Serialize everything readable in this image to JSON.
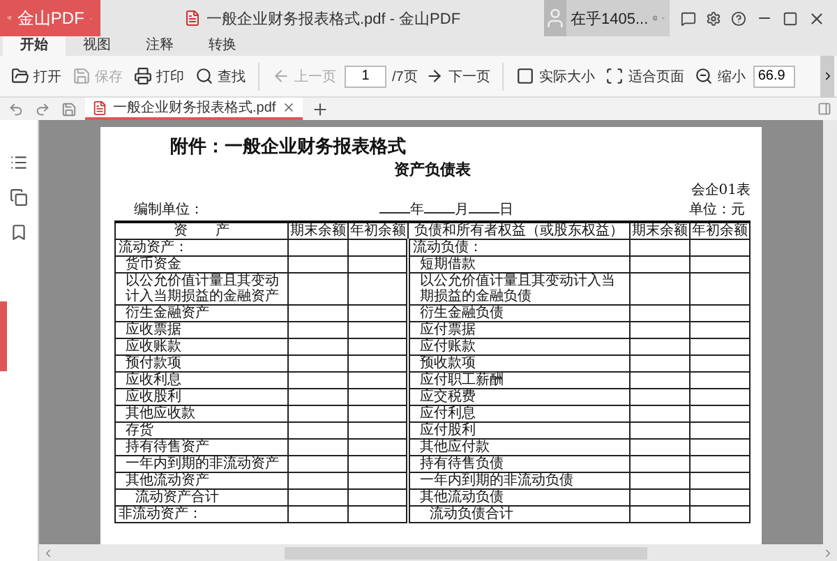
{
  "app": {
    "logo": "金山PDF",
    "title": "一般企业财务报表格式.pdf - 金山PDF",
    "user": "在乎1405..."
  },
  "tabs": [
    {
      "label": "开始",
      "selected": true
    },
    {
      "label": "视图",
      "selected": false
    },
    {
      "label": "注释",
      "selected": false
    },
    {
      "label": "转换",
      "selected": false
    }
  ],
  "toolbar": [
    {
      "kind": "button",
      "label": "打开",
      "disabled": false
    },
    {
      "kind": "button",
      "label": "保存",
      "disabled": true
    },
    {
      "kind": "button",
      "label": "打印",
      "disabled": false
    },
    {
      "kind": "button",
      "label": "查找",
      "disabled": false
    },
    {
      "kind": "separator"
    },
    {
      "kind": "button",
      "label": "上一页",
      "disabled": true
    },
    {
      "kind": "page_input",
      "value": "1",
      "total": "/7页"
    },
    {
      "kind": "button",
      "label": "下一页",
      "disabled": false
    },
    {
      "kind": "separator"
    },
    {
      "kind": "button",
      "label": "实际大小",
      "disabled": false
    },
    {
      "kind": "button",
      "label": "适合页面",
      "disabled": false
    },
    {
      "kind": "button",
      "label": "缩小",
      "disabled": false
    },
    {
      "kind": "zoom_input",
      "value": "66.9"
    }
  ],
  "doc_tabs": [
    {
      "label": "一般企业财务报表格式.pdf",
      "selected": true
    }
  ],
  "document": {
    "heading": "附件：一般企业财务报表格式",
    "title": "资产负债表",
    "form_no": "会企01表",
    "prepared_by": "编制单位：",
    "date": [
      "年",
      "月",
      "日"
    ],
    "unit": "单位：元",
    "columns": [
      "资　　产",
      "期末余额",
      "年初余额",
      "负债和所有者权益（或股东权益）",
      "期末余额",
      "年初余额"
    ],
    "rows": [
      {
        "left": {
          "text": "流动资产：",
          "kind": "section"
        },
        "right": {
          "text": "流动负债：",
          "kind": "section"
        }
      },
      {
        "left": {
          "text": "货币资金",
          "kind": "item"
        },
        "right": {
          "text": "短期借款",
          "kind": "item"
        }
      },
      {
        "left": {
          "text": "以公允价值计量且其变动计入当期损益的金融资产",
          "kind": "item"
        },
        "right": {
          "text": "以公允价值计量且其变动计入当期损益的金融负债",
          "kind": "item"
        }
      },
      {
        "left": {
          "text": "衍生金融资产",
          "kind": "item"
        },
        "right": {
          "text": "衍生金融负债",
          "kind": "item"
        }
      },
      {
        "left": {
          "text": "应收票据",
          "kind": "item"
        },
        "right": {
          "text": "应付票据",
          "kind": "item"
        }
      },
      {
        "left": {
          "text": "应收账款",
          "kind": "item"
        },
        "right": {
          "text": "应付账款",
          "kind": "item"
        }
      },
      {
        "left": {
          "text": "预付款项",
          "kind": "item"
        },
        "right": {
          "text": "预收款项",
          "kind": "item"
        }
      },
      {
        "left": {
          "text": "应收利息",
          "kind": "item"
        },
        "right": {
          "text": "应付职工薪酬",
          "kind": "item"
        }
      },
      {
        "left": {
          "text": "应收股利",
          "kind": "item"
        },
        "right": {
          "text": "应交税费",
          "kind": "item"
        }
      },
      {
        "left": {
          "text": "其他应收款",
          "kind": "item"
        },
        "right": {
          "text": "应付利息",
          "kind": "item"
        }
      },
      {
        "left": {
          "text": "存货",
          "kind": "item"
        },
        "right": {
          "text": "应付股利",
          "kind": "item"
        }
      },
      {
        "left": {
          "text": "持有待售资产",
          "kind": "item"
        },
        "right": {
          "text": "其他应付款",
          "kind": "item"
        }
      },
      {
        "left": {
          "text": "一年内到期的非流动资产",
          "kind": "item"
        },
        "right": {
          "text": "持有待售负债",
          "kind": "item"
        }
      },
      {
        "left": {
          "text": "其他流动资产",
          "kind": "item"
        },
        "right": {
          "text": "一年内到期的非流动负债",
          "kind": "item"
        }
      },
      {
        "left": {
          "text": "流动资产合计",
          "kind": "total"
        },
        "right": {
          "text": "其他流动负债",
          "kind": "item"
        }
      },
      {
        "left": {
          "text": "非流动资产：",
          "kind": "section"
        },
        "right": {
          "text": "流动负债合计",
          "kind": "total"
        }
      }
    ]
  }
}
